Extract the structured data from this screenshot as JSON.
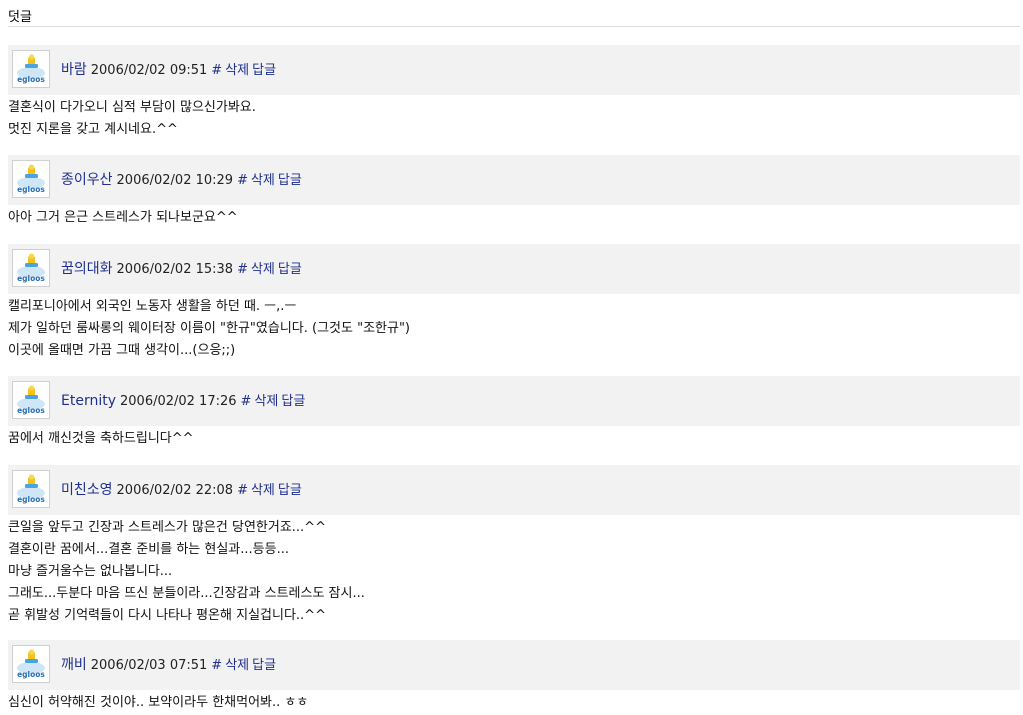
{
  "section": {
    "title": "덧글"
  },
  "avatar": {
    "label": "egloos",
    "icon": "egloos-avatar-icon"
  },
  "comments": [
    {
      "author": "바람",
      "date": "2006/02/02 09:51",
      "hash": "#",
      "delete_label": "삭제",
      "reply_label": "답글",
      "lines": [
        "결혼식이 다가오니 심적 부담이 많으신가봐요.",
        "멋진 지론을 갖고 계시네요.^^"
      ]
    },
    {
      "author": "종이우산",
      "date": "2006/02/02 10:29",
      "hash": "#",
      "delete_label": "삭제",
      "reply_label": "답글",
      "lines": [
        "아아 그거 은근 스트레스가 되나보군요^^"
      ]
    },
    {
      "author": "꿈의대화",
      "date": "2006/02/02 15:38",
      "hash": "#",
      "delete_label": "삭제",
      "reply_label": "답글",
      "lines": [
        "캘리포니아에서 외국인 노동자 생활을 하던 때. ㅡ,.ㅡ",
        "제가 일하던 룸싸롱의 웨이터장 이름이 \"한규\"였습니다. (그것도 \"조한규\")",
        "이곳에 올때면 가끔 그때 생각이...(으응;;)"
      ]
    },
    {
      "author": "Eternity",
      "date": "2006/02/02 17:26",
      "hash": "#",
      "delete_label": "삭제",
      "reply_label": "답글",
      "lines": [
        "꿈에서 깨신것을 축하드립니다^^"
      ]
    },
    {
      "author": "미친소영",
      "date": "2006/02/02 22:08",
      "hash": "#",
      "delete_label": "삭제",
      "reply_label": "답글",
      "lines": [
        "큰일을 앞두고 긴장과 스트레스가 많은건 당연한거죠...^^",
        "결혼이란 꿈에서...결혼 준비를 하는 현실과...등등...",
        "마냥 즐거울수는 없나봅니다...",
        "그래도...두분다 마음 뜨신 분들이라...긴장감과 스트레스도 잠시...",
        "곧 휘발성 기억력들이 다시 나타나 평온해 지실겁니다..^^"
      ]
    },
    {
      "author": "깨비",
      "date": "2006/02/03 07:51",
      "hash": "#",
      "delete_label": "삭제",
      "reply_label": "답글",
      "lines": [
        "심신이 허약해진 것이야.. 보약이라두 한채먹어봐.. ㅎㅎ"
      ]
    }
  ]
}
